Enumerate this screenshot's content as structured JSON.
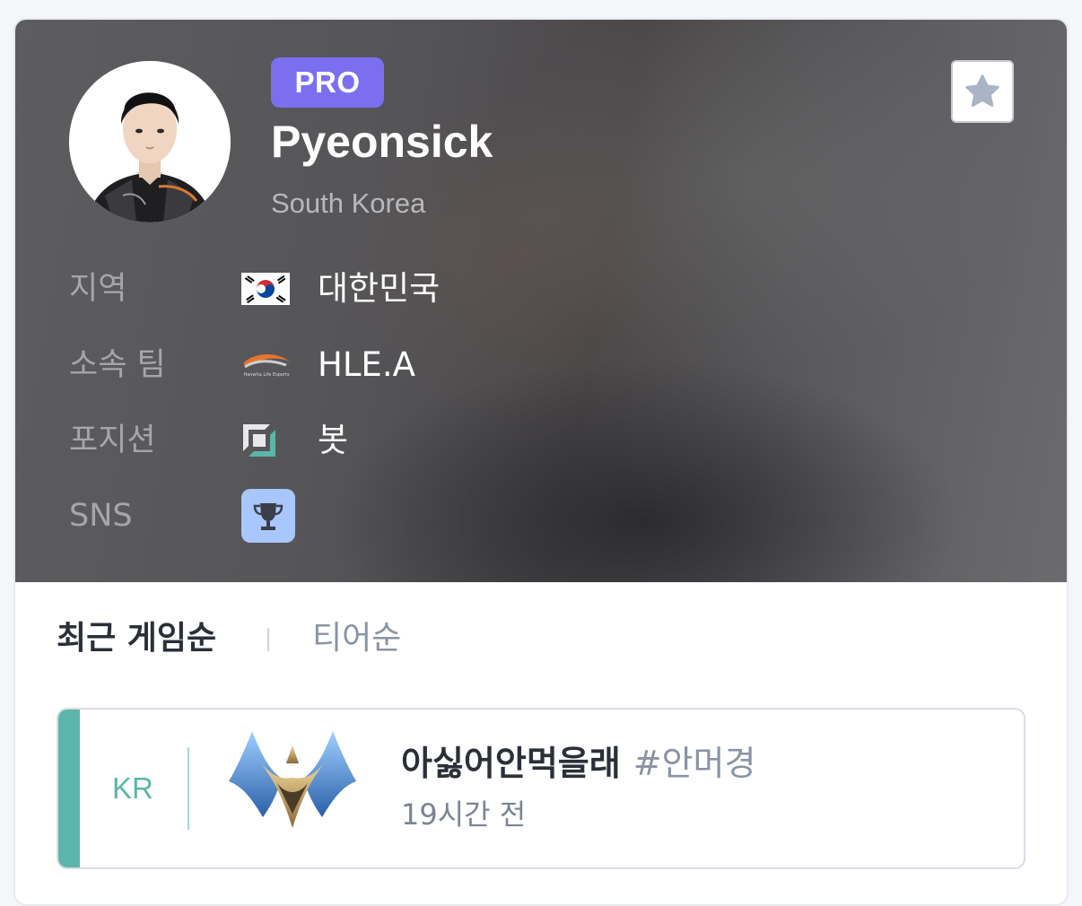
{
  "player": {
    "badge": "PRO",
    "name": "Pyeonsick",
    "country": "South Korea"
  },
  "info": [
    {
      "label": "지역",
      "value": "대한민국",
      "icon": "korea-flag-icon"
    },
    {
      "label": "소속 팀",
      "value": "HLE.A",
      "icon": "hle-team-logo"
    },
    {
      "label": "포지션",
      "value": "봇",
      "icon": "bot-position-icon"
    },
    {
      "label": "SNS",
      "value": "",
      "icon": "trophy-icon"
    }
  ],
  "team_logo_text": "Hanwha Life Esports",
  "sort": {
    "active": "최근 게임순",
    "inactive": "티어순"
  },
  "account": {
    "region": "KR",
    "name": "아싫어안먹을래",
    "tag": "#안머경",
    "last_played": "19시간 전",
    "tier_icon": "challenger-emblem-icon"
  },
  "colors": {
    "pro_badge": "#7b6ff0",
    "accent": "#5bb6a9",
    "sns_icon_bg": "#a9c7ff"
  }
}
